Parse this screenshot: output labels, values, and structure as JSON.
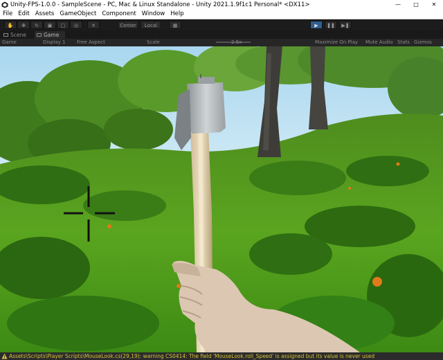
{
  "window": {
    "title": "Unity-FPS-1.0.0 - SampleScene - PC, Mac & Linux Standalone - Unity 2021.1.9f1c1 Personal* <DX11>"
  },
  "menu": [
    "File",
    "Edit",
    "Assets",
    "GameObject",
    "Component",
    "Window",
    "Help"
  ],
  "toolbar": {
    "pivot_label": "Center",
    "space_label": "Local"
  },
  "tabs": [
    {
      "label": "Scene",
      "active": false
    },
    {
      "label": "Game",
      "active": true
    }
  ],
  "game_bar": {
    "display_mode": "Game",
    "display": "Display 1",
    "aspect": "Free Aspect",
    "scale_label": "Scale",
    "scale_value": "2.6x",
    "maximize": "Maximize On Play",
    "mute": "Mute Audio",
    "stats": "Stats",
    "gizmos": "Gizmos"
  },
  "console": {
    "message": "Assets\\Scripts\\Player Scripts\\MouseLook.cs(29,19): warning CS0414: The field 'MouseLook.roll_Speed' is assigned but its value is never used"
  },
  "colors": {
    "editor_bg": "#1c1c1c",
    "play_active": "#2f5f8f",
    "warning_text": "#d7c23c",
    "sky": "#bfe3f5",
    "grass": "#4f9a1c"
  }
}
